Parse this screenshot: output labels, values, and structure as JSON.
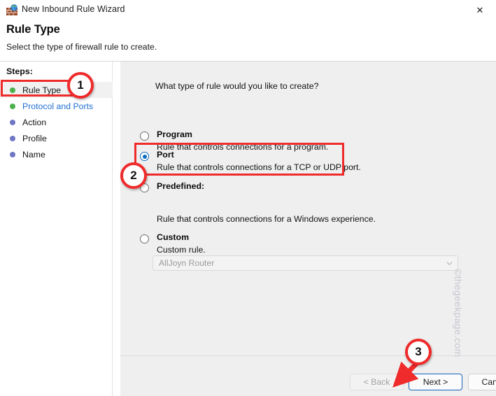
{
  "window": {
    "title": "New Inbound Rule Wizard",
    "icon": "firewall-globe-icon",
    "close_label": "✕"
  },
  "header": {
    "title": "Rule Type",
    "subtitle": "Select the type of firewall rule to create."
  },
  "sidebar": {
    "label": "Steps:",
    "items": [
      {
        "label": "Rule Type",
        "bullet_color": "#4cb04c",
        "state": "current",
        "link": false
      },
      {
        "label": "Protocol and Ports",
        "bullet_color": "#4cb04c",
        "state": "completed",
        "link": true
      },
      {
        "label": "Action",
        "bullet_color": "#6f77c4",
        "state": "pending",
        "link": false
      },
      {
        "label": "Profile",
        "bullet_color": "#6f77c4",
        "state": "pending",
        "link": false
      },
      {
        "label": "Name",
        "bullet_color": "#6f77c4",
        "state": "pending",
        "link": false
      }
    ]
  },
  "main": {
    "question": "What type of rule would you like to create?",
    "options": [
      {
        "title": "Program",
        "description": "Rule that controls connections for a program.",
        "selected": false,
        "disabled": false
      },
      {
        "title": "Port",
        "description": "Rule that controls connections for a TCP or UDP port.",
        "selected": true,
        "disabled": false
      },
      {
        "title": "Predefined:",
        "description": "Rule that controls connections for a Windows experience.",
        "selected": false,
        "disabled": false
      },
      {
        "title": "Custom",
        "description": "Custom rule.",
        "selected": false,
        "disabled": false
      }
    ],
    "predefined_dropdown": {
      "value": "AllJoyn Router",
      "disabled": true
    }
  },
  "footer": {
    "back_label": "< Back",
    "next_label": "Next >",
    "cancel_label": "Cancel"
  },
  "annotations": {
    "step_one": "1",
    "step_two": "2",
    "step_three": "3",
    "accent_color": "#ef2b2b"
  },
  "watermark": {
    "text": "©thegeekpage.com"
  }
}
